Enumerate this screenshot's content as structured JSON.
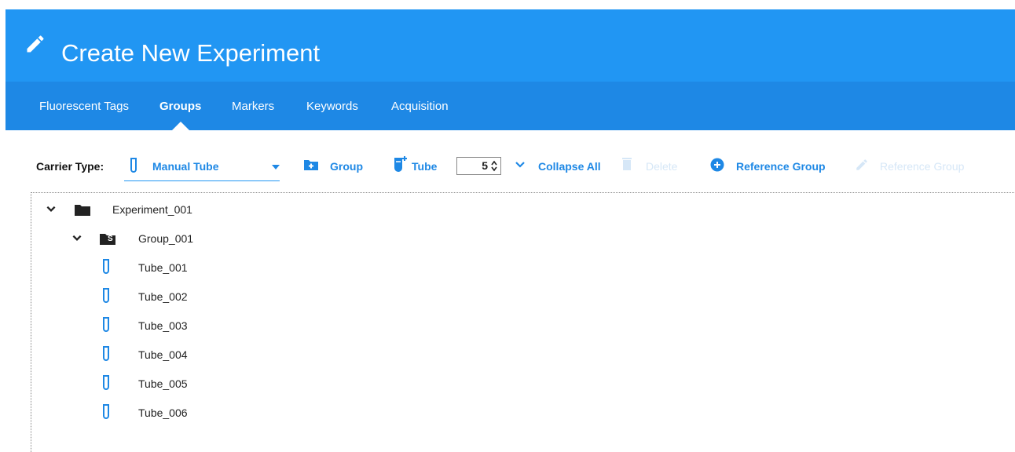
{
  "header": {
    "title": "Create New Experiment",
    "icon": "pencil-icon"
  },
  "tabs": [
    {
      "label": "Fluorescent Tags",
      "active": false
    },
    {
      "label": "Groups",
      "active": true
    },
    {
      "label": "Markers",
      "active": false
    },
    {
      "label": "Keywords",
      "active": false
    },
    {
      "label": "Acquisition",
      "active": false
    }
  ],
  "toolbar": {
    "carrier_label": "Carrier Type:",
    "carrier_value": "Manual Tube",
    "group_label": "Group",
    "tube_label": "Tube",
    "tube_count": "5",
    "collapse_label": "Collapse All",
    "delete_label": "Delete",
    "add_reference_label": "Reference Group",
    "edit_reference_label": "Reference Group"
  },
  "tree": {
    "experiment": "Experiment_001",
    "group": "Group_001",
    "group_badge": "S",
    "tubes": [
      "Tube_001",
      "Tube_002",
      "Tube_003",
      "Tube_004",
      "Tube_005",
      "Tube_006"
    ]
  },
  "colors": {
    "header": "#2196f3",
    "tabbar": "#1e88e5",
    "accent": "#1e88e5",
    "disabled": "#d6e7f7"
  }
}
